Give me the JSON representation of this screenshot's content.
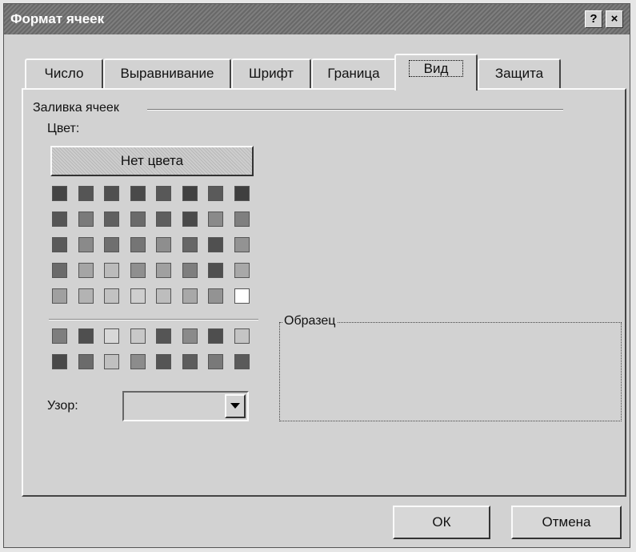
{
  "window": {
    "title": "Формат ячеек",
    "help_label": "?",
    "close_label": "×"
  },
  "tabs": [
    {
      "label": "Число",
      "active": false
    },
    {
      "label": "Выравнивание",
      "active": false
    },
    {
      "label": "Шрифт",
      "active": false
    },
    {
      "label": "Граница",
      "active": false
    },
    {
      "label": "Вид",
      "active": true
    },
    {
      "label": "Защита",
      "active": false
    }
  ],
  "fill_group": {
    "title": "Заливка ячеек",
    "color_label": "Цвет:",
    "no_color_button": "Нет цвета",
    "palette_rows": [
      [
        "#444444",
        "#555555",
        "#505050",
        "#4a4a4a",
        "#585858",
        "#404040",
        "#5a5a5a",
        "#3f3f3f"
      ],
      [
        "#555555",
        "#7a7a7a",
        "#606060",
        "#6a6a6a",
        "#5e5e5e",
        "#4a4a4a",
        "#8a8a8a",
        "#7f7f7f"
      ],
      [
        "#5a5a5a",
        "#8a8a8a",
        "#6f6f6f",
        "#757575",
        "#8e8e8e",
        "#666666",
        "#505050",
        "#939393"
      ],
      [
        "#6a6a6a",
        "#a5a5a5",
        "#bbbbbb",
        "#8f8f8f",
        "#a0a0a0",
        "#7e7e7e",
        "#4f4f4f",
        "#a8a8a8"
      ],
      [
        "#a0a0a0",
        "#b3b3b3",
        "#c2c2c2",
        "#cfcfcf",
        "#bdbdbd",
        "#a8a8a8",
        "#939393",
        "#ffffff"
      ]
    ],
    "extra_rows": [
      [
        "#7e7e7e",
        "#4f4f4f",
        "#d8d8d8",
        "#c8c8c8",
        "#555555",
        "#8a8a8a",
        "#4e4e4e",
        "#c4c4c4"
      ],
      [
        "#4a4a4a",
        "#6b6b6b",
        "#c0c0c0",
        "#8c8c8c",
        "#555555",
        "#5d5d5d",
        "#797979",
        "#5a5a5a"
      ]
    ],
    "pattern_label": "Узор:",
    "pattern_value": ""
  },
  "sample_group": {
    "title": "Образец"
  },
  "footer": {
    "ok_label": "ОК",
    "cancel_label": "Отмена"
  }
}
